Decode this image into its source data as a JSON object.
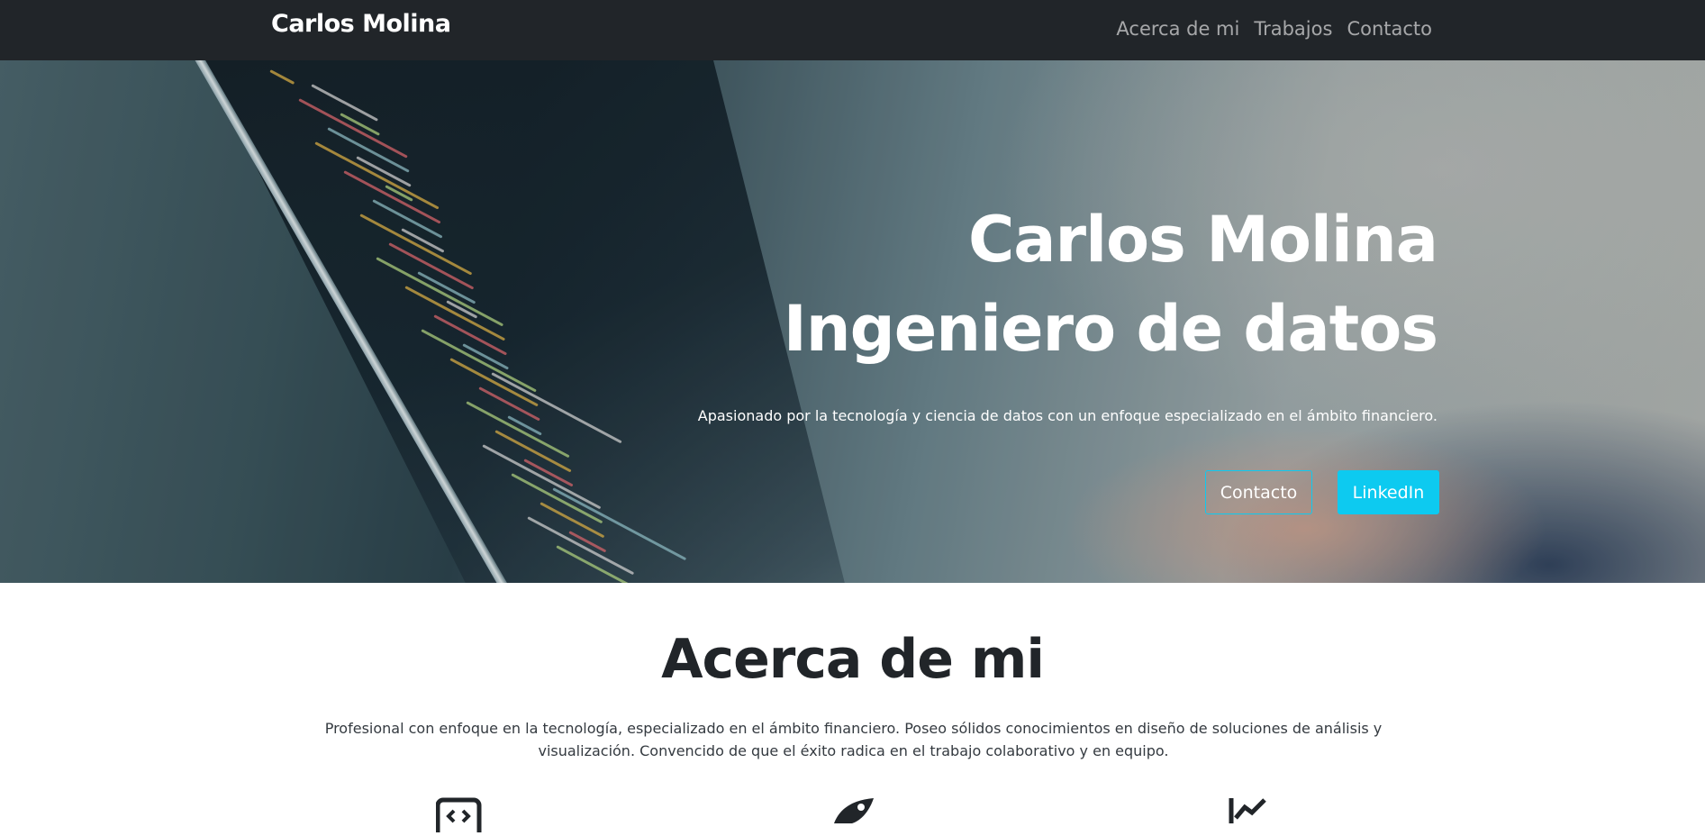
{
  "navbar": {
    "brand": "Carlos Molina",
    "links": [
      "Acerca de mi",
      "Trabajos",
      "Contacto"
    ]
  },
  "hero": {
    "title_line1": "Carlos Molina",
    "title_line2": "Ingeniero de datos",
    "subtitle": "Apasionado por la tecnología y ciencia de datos con un enfoque especializado en el ámbito financiero.",
    "buttons": {
      "contact": "Contacto",
      "linkedin": "LinkedIn"
    }
  },
  "about": {
    "title": "Acerca de mi",
    "text": "Profesional con enfoque en la tecnología, especializado en el ámbito financiero. Poseo sólidos conocimientos en diseño de soluciones de análisis y visualización. Convencido de que el éxito radica en el trabajo colaborativo y en equipo.",
    "icons": [
      "code-icon",
      "rocket-icon",
      "chart-line-icon"
    ]
  },
  "colors": {
    "navbar_bg": "#212529",
    "accent": "#0dcaf0",
    "text_dark": "#212529"
  }
}
